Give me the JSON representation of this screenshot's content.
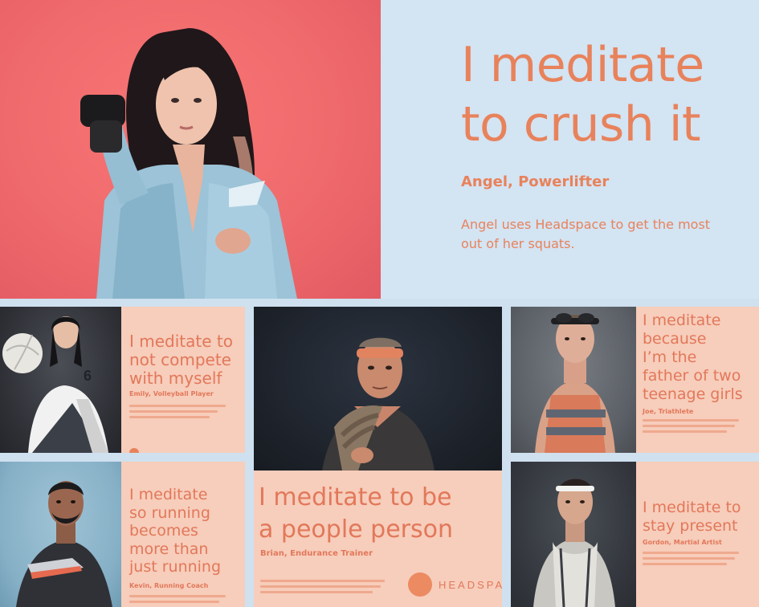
{
  "hero": {
    "title_line1": "I meditate",
    "title_line2": "to crush it",
    "subtitle": "Angel, Powerlifter",
    "description": "Angel uses Headspace to get the most out of her squats."
  },
  "cards": {
    "emily": {
      "title_line1": "I meditate to",
      "title_line2": "not compete",
      "title_line3": "with myself",
      "name": "Emily, Volleyball Player"
    },
    "brian": {
      "title_line1": "I meditate to be",
      "title_line2": "a people person",
      "name": "Brian, Endurance Trainer",
      "logo_text": "HEADSPACE"
    },
    "joe": {
      "title_line1": "I meditate",
      "title_line2": "because",
      "title_line3": "I’m the",
      "title_line4": "father of two",
      "title_line5": "teenage girls",
      "name": "Joe, Triathlete"
    },
    "runner": {
      "title_line1": "I meditate",
      "title_line2": "so running",
      "title_line3": "becomes",
      "title_line4": "more than",
      "title_line5": "just running",
      "name": "Kevin, Running Coach"
    },
    "martial": {
      "title_line1": "I meditate to",
      "title_line2": "stay present",
      "name": "Gordon, Martial Artist"
    }
  },
  "colors": {
    "accent": "#e8825b",
    "card_bg": "#f7cdbb",
    "hero_bg": "#d3e4f3",
    "hero_photo_bg": "#f07070",
    "page_bg": "#cfe0ef"
  }
}
